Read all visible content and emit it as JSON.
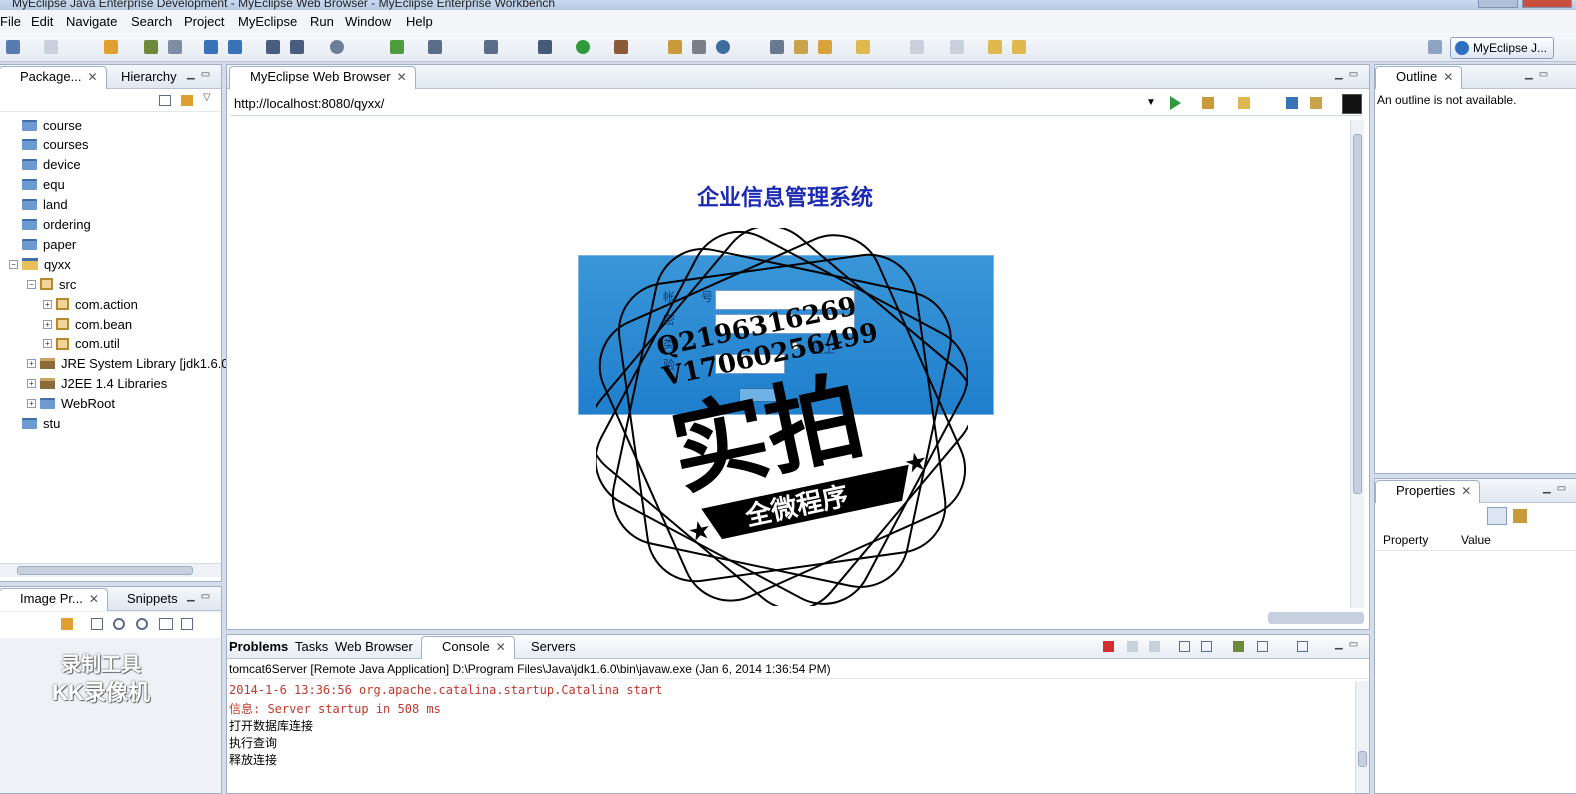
{
  "window": {
    "title": "MyEclipse Java Enterprise Development - MyEclipse Web Browser - MyEclipse Enterprise Workbench"
  },
  "menu": [
    "File",
    "Edit",
    "Navigate",
    "Search",
    "Project",
    "MyEclipse",
    "Run",
    "Window",
    "Help"
  ],
  "perspective": {
    "label": "MyEclipse J..."
  },
  "left_pane": {
    "tabs": [
      "Package...",
      "Hierarchy"
    ],
    "tree": [
      {
        "label": "course",
        "type": "folder",
        "depth": 0
      },
      {
        "label": "courses",
        "type": "folder",
        "depth": 0
      },
      {
        "label": "device",
        "type": "folder",
        "depth": 0
      },
      {
        "label": "equ",
        "type": "folder",
        "depth": 0
      },
      {
        "label": "land",
        "type": "folder",
        "depth": 0
      },
      {
        "label": "ordering",
        "type": "folder",
        "depth": 0
      },
      {
        "label": "paper",
        "type": "folder",
        "depth": 0
      },
      {
        "label": "qyxx",
        "type": "project",
        "depth": 0,
        "expanded": true
      },
      {
        "label": "src",
        "type": "pkg",
        "depth": 1,
        "expanded": true
      },
      {
        "label": "com.action",
        "type": "pkg",
        "depth": 2
      },
      {
        "label": "com.bean",
        "type": "pkg",
        "depth": 2
      },
      {
        "label": "com.util",
        "type": "pkg",
        "depth": 2
      },
      {
        "label": "JRE System Library [jdk1.6.0",
        "type": "lib",
        "depth": 1
      },
      {
        "label": "J2EE 1.4 Libraries",
        "type": "lib",
        "depth": 1
      },
      {
        "label": "WebRoot",
        "type": "folder",
        "depth": 1
      },
      {
        "label": "stu",
        "type": "folder",
        "depth": 0
      }
    ]
  },
  "left_bottom_pane": {
    "tabs": [
      "Image Pr...",
      "Snippets"
    ]
  },
  "editor": {
    "tab": "MyEclipse Web Browser",
    "url": "http://localhost:8080/qyxx/",
    "page_title": "企业信息管理系统",
    "watermark": {
      "line1": "Q2196316269",
      "line2": "V17060256499",
      "big": "实拍",
      "banner": "全微程序"
    }
  },
  "outline": {
    "tab": "Outline",
    "message": "An outline is not available."
  },
  "properties": {
    "tab": "Properties",
    "col_property": "Property",
    "col_value": "Value"
  },
  "bottom": {
    "tabs": [
      "Problems",
      "Tasks",
      "Web Browser",
      "Console",
      "Servers"
    ],
    "header": "tomcat6Server [Remote Java Application] D:\\Program Files\\Java\\jdk1.6.0\\bin\\javaw.exe (Jan 6, 2014 1:36:54 PM)",
    "lines": [
      {
        "text": "2014-1-6 13:36:56 org.apache.catalina.startup.Catalina start",
        "color": "#c0392b"
      },
      {
        "text": "信息: Server startup in 508 ms",
        "color": "#c0392b"
      },
      {
        "text": "打开数据库连接",
        "color": "#000000"
      },
      {
        "text": "执行查询",
        "color": "#000000"
      },
      {
        "text": "释放连接",
        "color": "#000000"
      }
    ]
  },
  "recorder_watermark": {
    "line1": "录制工具",
    "line2": "KK录像机"
  }
}
